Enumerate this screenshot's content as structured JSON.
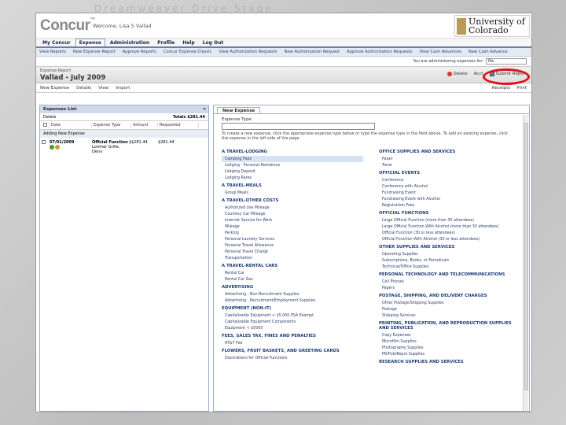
{
  "watermark": "Dreamweaver Drive Stage",
  "header": {
    "logo": "Concur",
    "logo_tm": "™",
    "welcome": "Welcome, Lisa S Vallad",
    "university_line1": "University of",
    "university_line2": "Colorado"
  },
  "main_nav": [
    "My Concur",
    "Expense",
    "Administration",
    "Profile",
    "Help",
    "Log Out"
  ],
  "sub_nav": [
    "View Reports",
    "New Expense Report",
    "Approve Reports",
    "Concur Expense Classic",
    "View Authorization Requests",
    "New Authorization Request",
    "Approve Authorization Requests",
    "View Cash Advances",
    "New Cash Advance"
  ],
  "admin": {
    "label": "You are administering expenses for:",
    "value": "Me"
  },
  "report": {
    "subtitle": "Expense Report",
    "title": "Vallad - July 2009",
    "delete": "Delete",
    "acct": "Acct",
    "submit": "Submit Report"
  },
  "toolbar": {
    "new_expense": "New Expense",
    "details": "Details",
    "view": "View",
    "import": "Import",
    "receipts": "Receipts",
    "print": "Print"
  },
  "left": {
    "title": "Expenses List",
    "collapse": "«",
    "delete": "Delete",
    "totals": "Totals $281.44",
    "columns": [
      "",
      "Date",
      "Expense Type",
      "Amount",
      "Requested"
    ],
    "adding": "Adding New Expense",
    "row": {
      "date": "07/01/2009",
      "type": "Official Function (",
      "type2": "Lorimer Grille, Denv",
      "amount": "$281.44",
      "requested": "$281.44"
    }
  },
  "right": {
    "tab": "New Expense",
    "expense_type_label": "Expense Type",
    "instructions": "To create a new expense, click the appropriate expense type below or type the expense type in the field above. To add an existing expense, click the expense in the left side of the page.",
    "col1": [
      {
        "cat": "A TRAVEL-LODGING",
        "items": [
          "Camping Fees",
          "Lodging - Personal Residence",
          "Lodging Deposit",
          "Lodging Rates"
        ]
      },
      {
        "cat": "A TRAVEL-MEALS",
        "items": [
          "Group Meals"
        ]
      },
      {
        "cat": "A TRAVEL-OTHER COSTS",
        "items": [
          "Authorized Use Mileage",
          "Courtesy Car Mileage",
          "Internet Service for Work",
          "Mileage",
          "Parking",
          "Personal Laundry Services",
          "Personal Travel Allowance",
          "Personal Travel Charge",
          "Transportation"
        ]
      },
      {
        "cat": "A TRAVEL-RENTAL CARS",
        "items": [
          "Rental Car",
          "Rental Car Gas"
        ]
      },
      {
        "cat": "ADVERTISING",
        "items": [
          "Advertising - Non-Recruitment Supplies",
          "Advertising - Recruitment/Employment Supplies"
        ]
      },
      {
        "cat": "EQUIPMENT (NON-IT)",
        "items": [
          "Capitalizable Equipment < $5,000 PSA Exempt",
          "Capitalizable Equipment Components",
          "Equipment < $5000"
        ]
      },
      {
        "cat": "FEES, SALES TAX, FINES AND PENALTIES",
        "items": [
          "AT&T Fee"
        ]
      },
      {
        "cat": "FLOWERS, FRUIT BASKETS, AND GREETING CARDS",
        "items": [
          "Decorations for Official Functions"
        ]
      }
    ],
    "col2": [
      {
        "cat": "OFFICE SUPPLIES AND SERVICES",
        "items": [
          "Paper",
          "Toner"
        ]
      },
      {
        "cat": "OFFICIAL EVENTS",
        "items": [
          "Conference",
          "Conference with Alcohol",
          "Fundraising Event",
          "Fundraising Event with Alcohol",
          "Registration Fees"
        ]
      },
      {
        "cat": "OFFICIAL FUNCTIONS",
        "items": [
          "Large Official Function (more than 30 attendees)",
          "Large Official Function With Alcohol (more than 30 attendees)",
          "Official Function (30 or less attendees)",
          "Official Function With Alcohol (30 or less attendees)"
        ]
      },
      {
        "cat": "OTHER SUPPLIES AND SERVICES",
        "items": [
          "Operating Supplies",
          "Subscriptions, Books, or Periodicals",
          "Technical/Office Supplies"
        ]
      },
      {
        "cat": "PERSONAL TECHNOLOGY AND TELECOMMUNICATIONS",
        "items": [
          "Cell Phones",
          "Pagers"
        ]
      },
      {
        "cat": "POSTAGE, SHIPPING, AND DELIVERY CHARGES",
        "items": [
          "Other Postage/Shipping Supplies",
          "Postage",
          "Shipping Services"
        ]
      },
      {
        "cat": "PRINTING, PUBLICATION, AND REPRODUCTION SUPPLIES AND SERVICES",
        "items": [
          "Copy Expenses",
          "Microfilm Supplies",
          "Photography Supplies",
          "PR/Pub/Repro Supplies"
        ]
      },
      {
        "cat": "RESEARCH SUPPLIES AND SERVICES",
        "items": []
      }
    ]
  }
}
